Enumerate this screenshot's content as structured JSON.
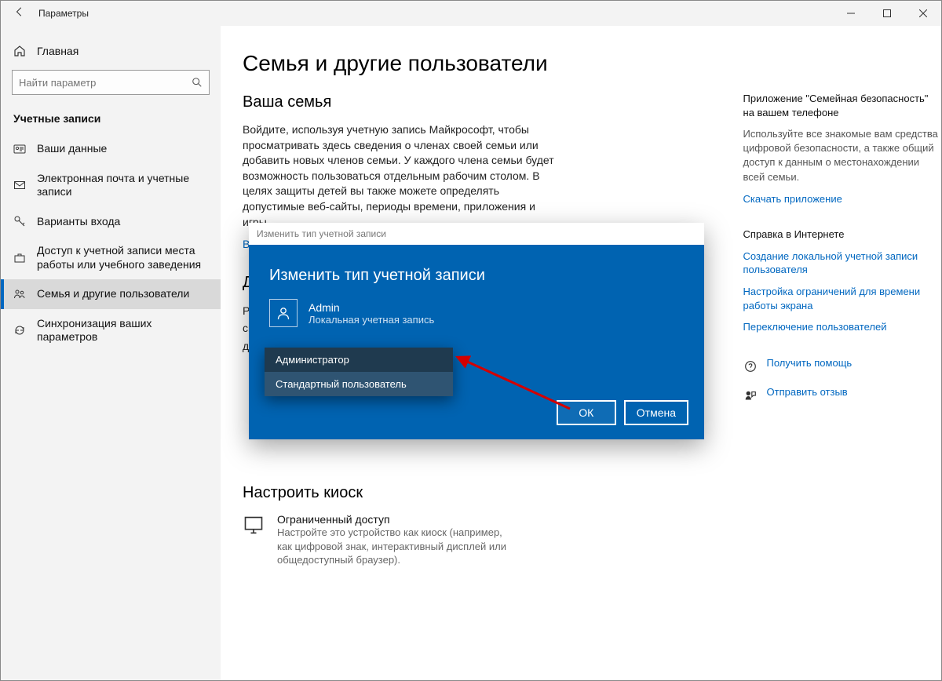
{
  "window": {
    "title": "Параметры"
  },
  "sidebar": {
    "home": "Главная",
    "search_placeholder": "Найти параметр",
    "category": "Учетные записи",
    "items": [
      "Ваши данные",
      "Электронная почта и учетные записи",
      "Варианты входа",
      "Доступ к учетной записи места работы или учебного заведения",
      "Семья и другие пользователи",
      "Синхронизация ваших параметров"
    ]
  },
  "main": {
    "page_title": "Семья и другие пользователи",
    "section1_title": "Ваша семья",
    "section1_desc": "Войдите, используя учетную запись Майкрософт, чтобы просматривать здесь сведения о членах своей семьи или добавить новых членов семьи. У каждого члена семьи будет возможность пользоваться отдельным рабочим столом. В целях защиты детей вы также можете определять допустимые веб-сайты, периоды времени, приложения и игры.",
    "section1_link": "Войти с учетной записи Майкрософт",
    "truncated_heading": "Д",
    "truncated_line1": "Ра",
    "truncated_line2": "си",
    "truncated_line3": "до",
    "kiosk_title": "Настроить киоск",
    "kiosk_item_title": "Ограниченный доступ",
    "kiosk_item_desc": "Настройте это устройство как киоск (например, как цифровой знак, интерактивный дисплей или общедоступный браузер)."
  },
  "right": {
    "app_heading": "Приложение \"Семейная безопасность\" на вашем телефоне",
    "app_desc": "Используйте все знакомые вам средства цифровой безопасности, а также общий доступ к данным о местонахождении всей семьи.",
    "app_link": "Скачать приложение",
    "help_heading": "Справка в Интернете",
    "help_links": [
      "Создание локальной учетной записи пользователя",
      "Настройка ограничений для времени работы экрана",
      "Переключение пользователей"
    ],
    "get_help": "Получить помощь",
    "feedback": "Отправить отзыв"
  },
  "dialog": {
    "titlebar": "Изменить тип учетной записи",
    "heading": "Изменить тип учетной записи",
    "user_name": "Admin",
    "user_type": "Локальная учетная запись",
    "options": [
      "Администратор",
      "Стандартный пользователь"
    ],
    "ok": "ОК",
    "cancel": "Отмена"
  }
}
